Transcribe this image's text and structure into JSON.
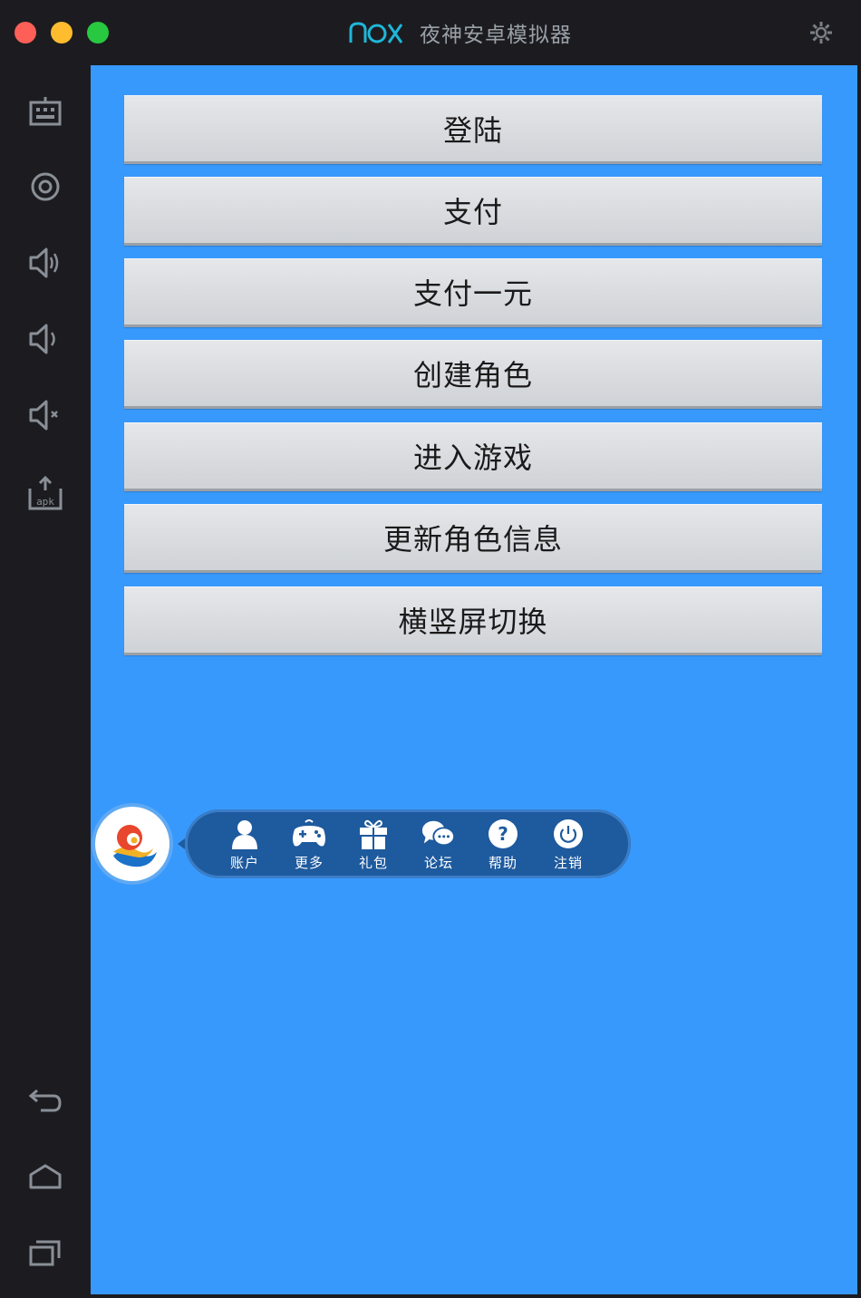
{
  "window": {
    "brand_logo_text": "nox",
    "title": "夜神安卓模拟器"
  },
  "sidebar": {
    "items": [
      {
        "name": "keyboard-icon"
      },
      {
        "name": "location-icon"
      },
      {
        "name": "volume-up-icon"
      },
      {
        "name": "volume-down-icon"
      },
      {
        "name": "mute-icon"
      },
      {
        "name": "apk-install-icon"
      },
      {
        "name": "back-icon"
      },
      {
        "name": "home-icon"
      },
      {
        "name": "recent-apps-icon"
      }
    ]
  },
  "buttons": {
    "login": "登陆",
    "pay": "支付",
    "pay_one_yuan": "支付一元",
    "create_role": "创建角色",
    "enter_game": "进入游戏",
    "update_role_info": "更新角色信息",
    "switch_orientation": "横竖屏切换"
  },
  "float_menu": {
    "account": "账户",
    "more": "更多",
    "gift": "礼包",
    "forum": "论坛",
    "help": "帮助",
    "logout": "注销"
  },
  "colors": {
    "screen_bg": "#3899fd",
    "chrome_bg": "#1c1c20",
    "menu_bg": "#1e5a9e",
    "brand_cyan": "#1fb6d9"
  }
}
